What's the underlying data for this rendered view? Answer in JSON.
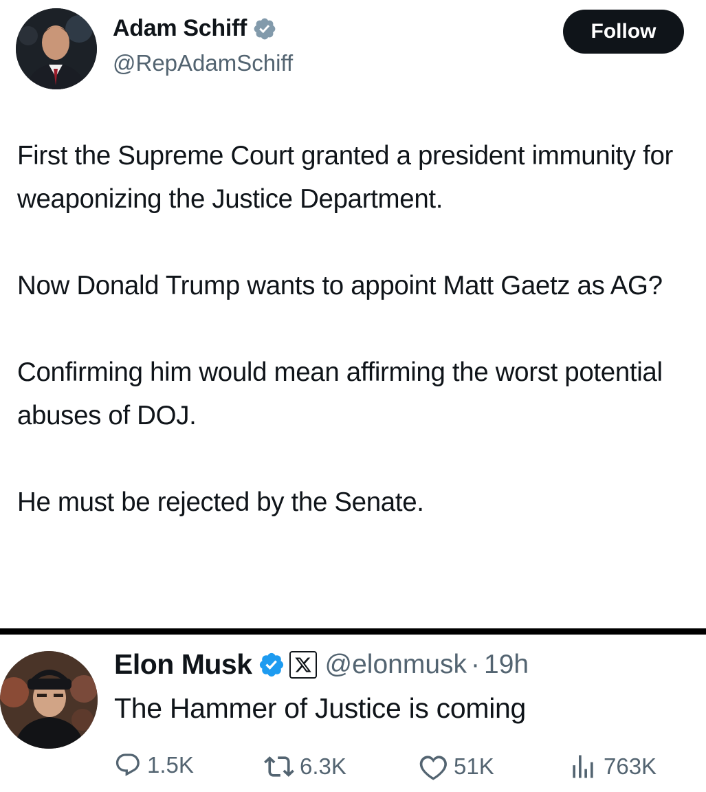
{
  "tweet1": {
    "display_name": "Adam Schiff",
    "handle": "@RepAdamSchiff",
    "follow_label": "Follow",
    "paragraphs": [
      "First the Supreme Court granted a president immunity for weaponizing the Justice Department.",
      "Now Donald Trump wants to appoint Matt Gaetz as AG?",
      "Confirming him would mean affirming the worst potential abuses of DOJ.",
      "He must be rejected by the Senate."
    ],
    "verified_icon": "verified-gray-badge-icon"
  },
  "tweet2": {
    "display_name": "Elon Musk",
    "handle": "@elonmusk",
    "separator": "·",
    "time": "19h",
    "text": "The Hammer of Justice is coming",
    "verified_icon": "verified-blue-badge-icon",
    "affiliation_icon": "x-logo-icon",
    "actions": {
      "replies": "1.5K",
      "reposts": "6.3K",
      "likes": "51K",
      "views": "763K"
    }
  },
  "colors": {
    "text": "#0f1419",
    "secondary": "#536471",
    "verified_blue": "#1d9bf0",
    "verified_gray": "#829aab",
    "button_bg": "#0f1419"
  }
}
